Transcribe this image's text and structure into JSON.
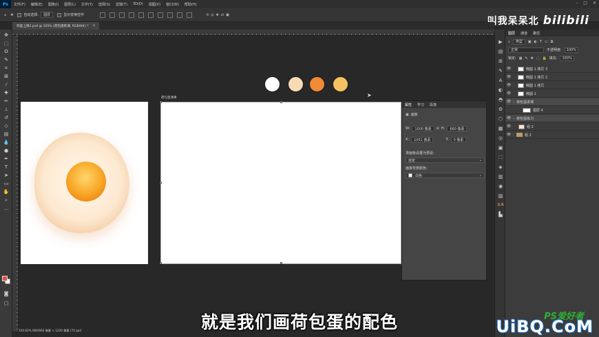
{
  "menu": [
    "文件(F)",
    "编辑(E)",
    "图像(I)",
    "图层(L)",
    "文字(Y)",
    "选择(S)",
    "滤镜(T)",
    "3D(D)",
    "视图(V)",
    "窗口(W)",
    "帮助(H)"
  ],
  "options": {
    "auto_select": "自动选择:",
    "auto_select_value": "图层",
    "show_transform": "显示变换控件"
  },
  "brand": {
    "text": "叫我呆呆北",
    "logo": "bilibili"
  },
  "document_tab": {
    "title": "鸡蛋上课2.psd @ 105% (荷包蛋练课, RGB/8#) *",
    "close": "×"
  },
  "artboard_label": "荷包蛋课课",
  "palette": [
    "#ffffff",
    "#f6dbb5",
    "#f08a36",
    "#f5c262"
  ],
  "properties": {
    "tabs": [
      "属性",
      "学习",
      "段落"
    ],
    "section": "画板",
    "w_label": "W:",
    "w_value": "1000 像素",
    "h_label": "H:",
    "h_value": "660 像素",
    "x_label": "X:",
    "x_value": "1051 像素",
    "y_label": "Y:",
    "y_value": "0 像素",
    "preset_label": "将画板设置为预设:",
    "preset_value": "自定",
    "bg_label": "画板背景颜色:",
    "bg_value": "白色"
  },
  "layers_panel": {
    "tabs": [
      "图层",
      "通道",
      "路径"
    ],
    "filter": "类型",
    "blend": "正常",
    "opacity_label": "不透明度:",
    "opacity_value": "100%",
    "lock_label": "锁定:",
    "fill_label": "填充:",
    "fill_value": "100%",
    "layers": [
      {
        "name": "椭圆 1 拷贝 3"
      },
      {
        "name": "椭圆 1 拷贝 2"
      },
      {
        "name": "椭圆 1 拷贝"
      },
      {
        "name": "椭圆 1"
      },
      {
        "name": "荷包蛋讲课",
        "group": true
      },
      {
        "name": "图层 4"
      },
      {
        "name": "荷包蛋练习",
        "group": true
      },
      {
        "name": "组 2"
      },
      {
        "name": "组 2"
      }
    ]
  },
  "right_icon_number": "2.6",
  "status": "104.62%   660/660 像素 × 1220 像素 (72 ppi)",
  "subtitle": "就是我们画荷包蛋的配色",
  "watermark": {
    "ps": "PS爱好者",
    "site": "UiBQ.CoM"
  }
}
